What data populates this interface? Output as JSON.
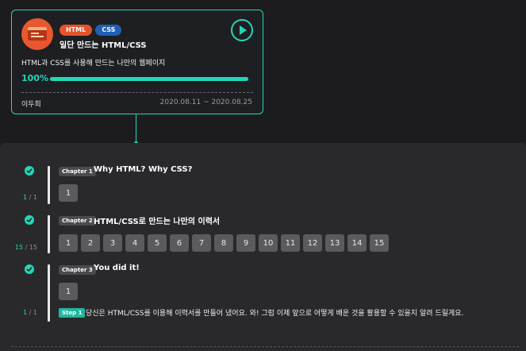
{
  "course": {
    "tags": [
      "HTML",
      "CSS"
    ],
    "title": "일단 만드는 HTML/CSS",
    "description": "HTML과 CSS를 사용해 만드는 나만의 웹페이지",
    "progress_label": "100%",
    "progress": 1.0,
    "author": "이두희",
    "period": "2020.08.11 ~ 2020.08.25"
  },
  "chapters": [
    {
      "label": "Chapter 1",
      "title": "Why HTML? Why CSS?",
      "completed": "1",
      "total": "/ 1",
      "lessons": [
        "1"
      ]
    },
    {
      "label": "Chapter 2",
      "title": "HTML/CSS로 만드는 나만의 이력서",
      "completed": "15",
      "total": "/ 15",
      "lessons": [
        "1",
        "2",
        "3",
        "4",
        "5",
        "6",
        "7",
        "8",
        "9",
        "10",
        "11",
        "12",
        "13",
        "14",
        "15"
      ]
    },
    {
      "label": "Chapter 3",
      "title": "You did it!",
      "completed": "1",
      "total": "/ 1",
      "lessons": [
        "1"
      ],
      "step": {
        "label": "Step 1",
        "text": "당신은 HTML/CSS를 이용해 이력서를 만들어 냈어요. 와! 그럼 이제 앞으로 어떻게 배운 것을 활용할 수 있을지 알려 드릴게요."
      }
    }
  ],
  "colors": {
    "accent": "#1fd8b8",
    "html": "#e4532c",
    "css": "#1f5fb5"
  }
}
